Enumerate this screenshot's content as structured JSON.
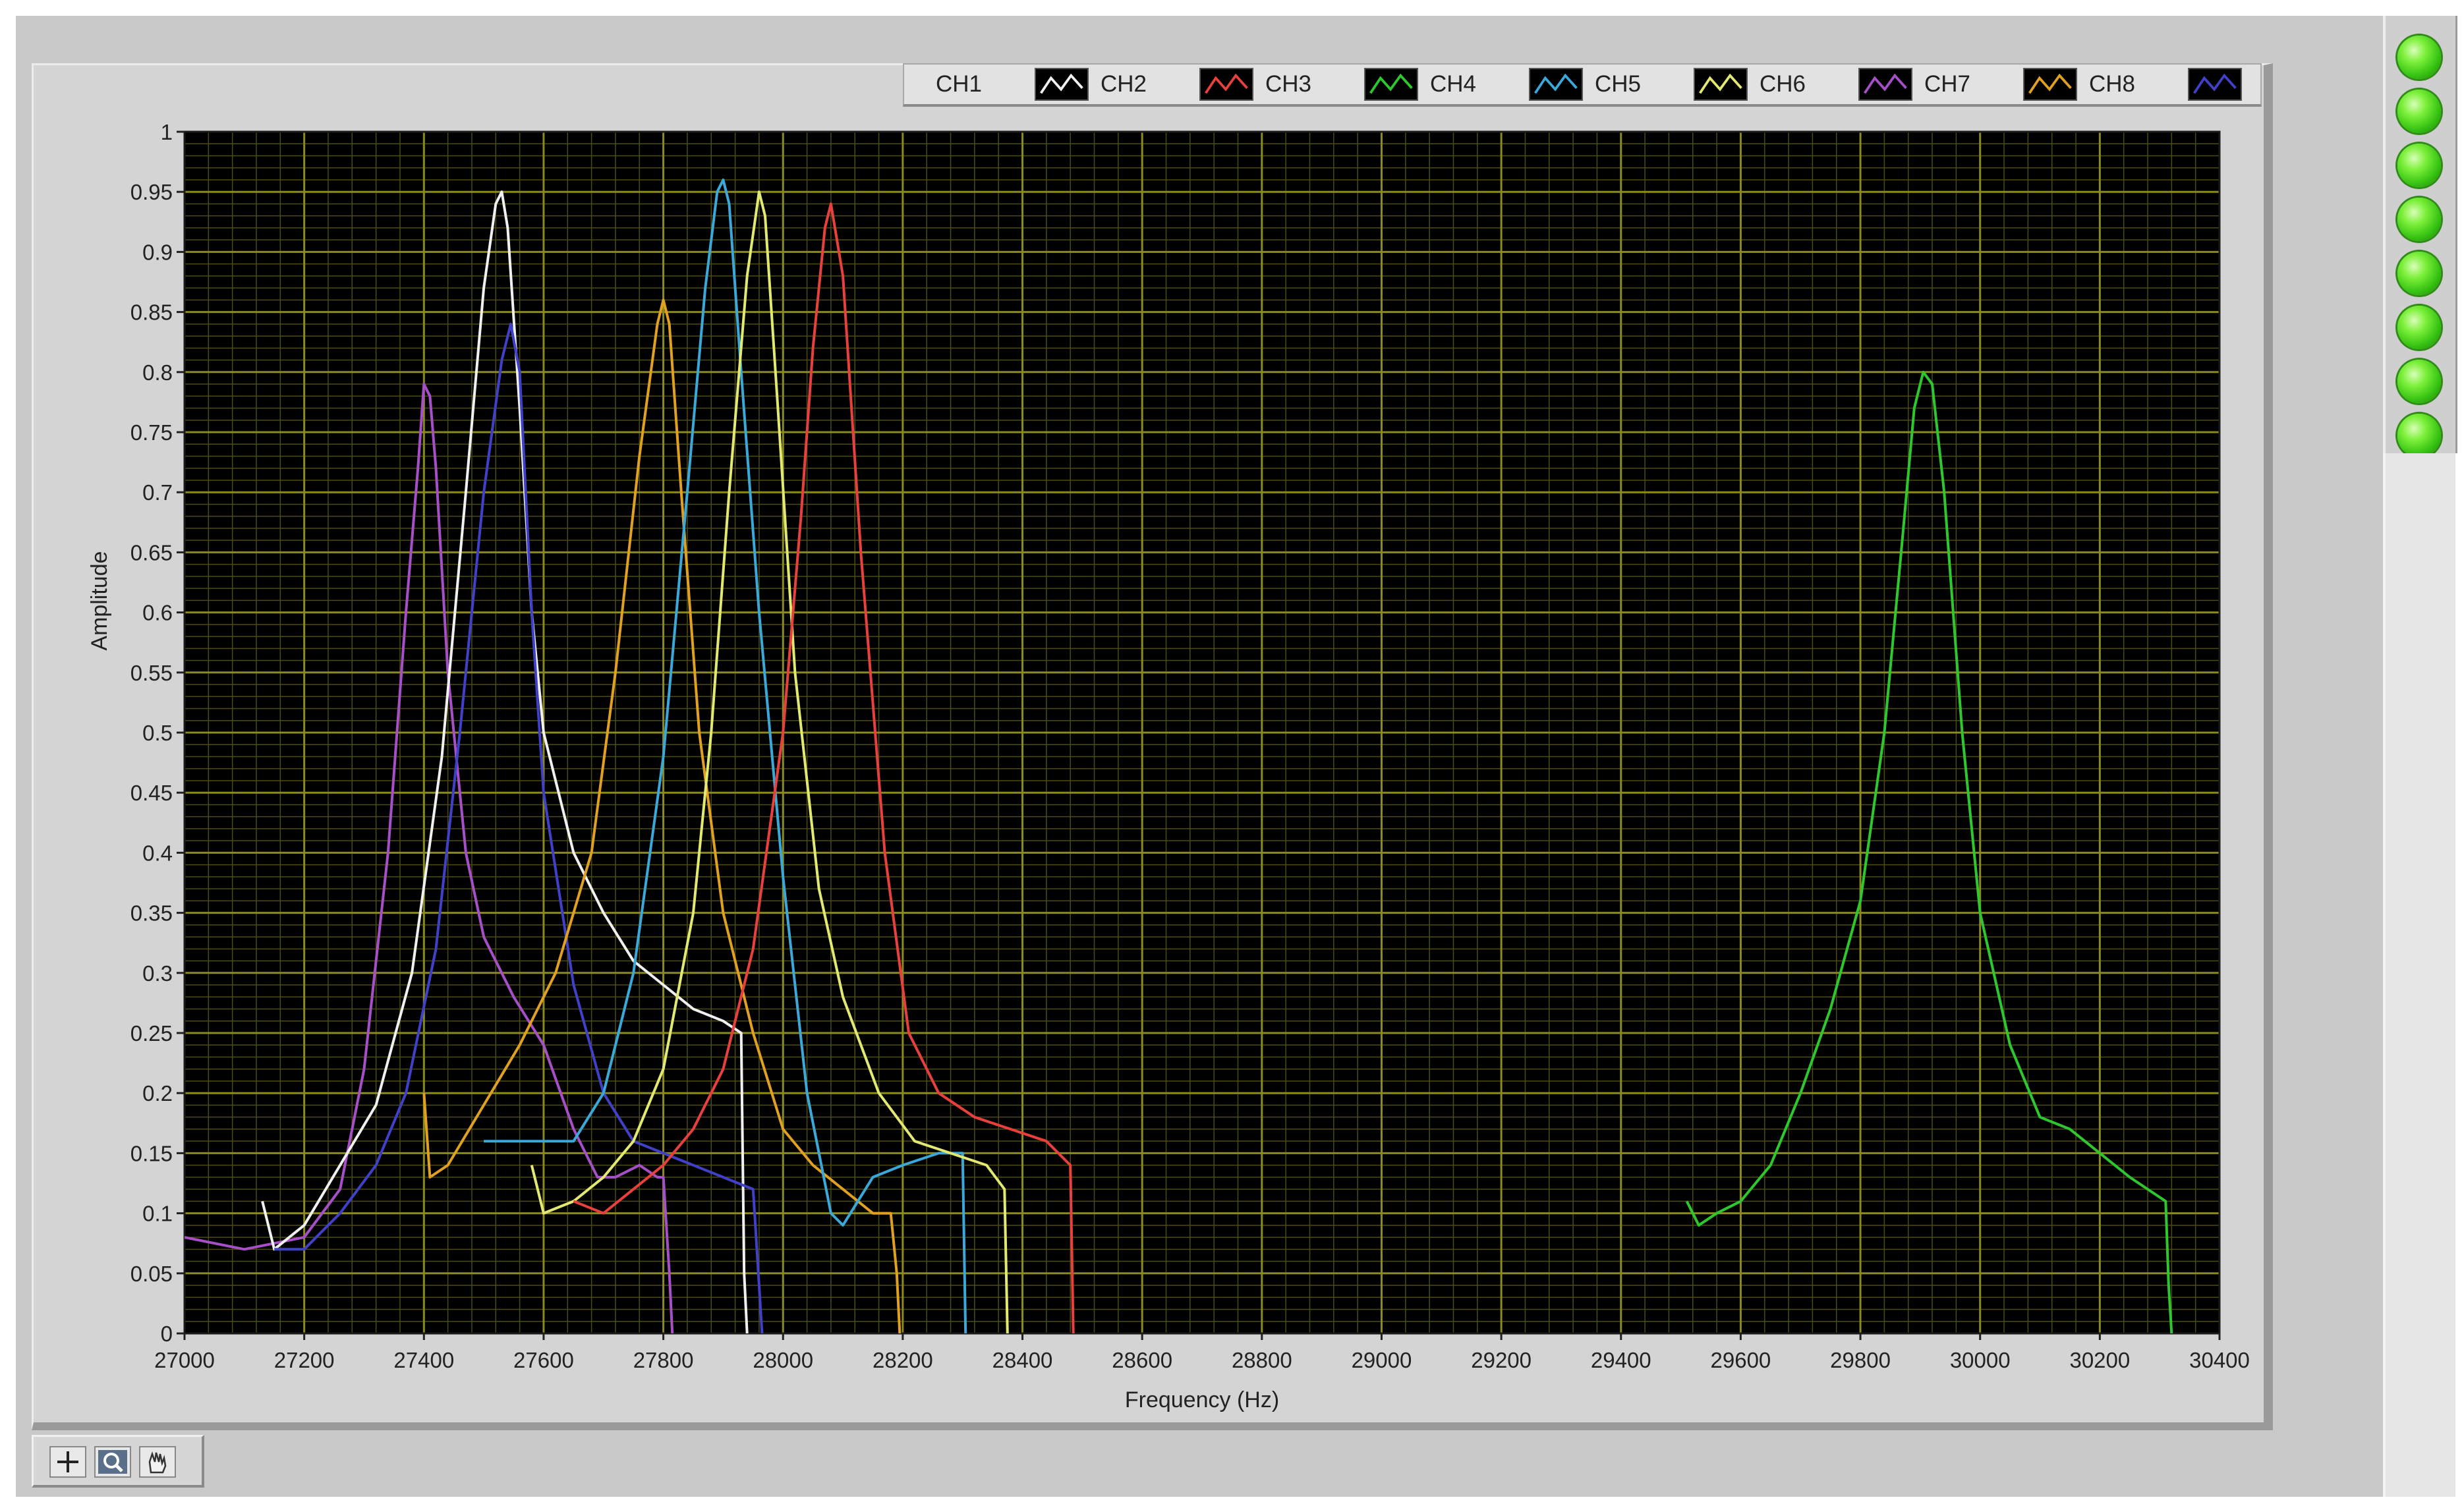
{
  "legend": {
    "items": [
      {
        "label": "CH1",
        "color": "#f0f0f0"
      },
      {
        "label": "CH2",
        "color": "#e8403c"
      },
      {
        "label": "CH3",
        "color": "#2ec82e"
      },
      {
        "label": "CH4",
        "color": "#3aa8d8"
      },
      {
        "label": "CH5",
        "color": "#e2e870"
      },
      {
        "label": "CH6",
        "color": "#a64fc8"
      },
      {
        "label": "CH7",
        "color": "#e0a020"
      },
      {
        "label": "CH8",
        "color": "#4040c8"
      }
    ]
  },
  "leds": {
    "count": 8,
    "state": "on",
    "color": "#36c212"
  },
  "toolbar": {
    "tools": [
      "cursor-move-icon",
      "zoom-icon",
      "pan-hand-icon"
    ]
  },
  "chart_data": {
    "type": "line",
    "xlabel": "Frequency (Hz)",
    "ylabel": "Amplitude",
    "xlim": [
      27000,
      30400
    ],
    "ylim": [
      0,
      1
    ],
    "x_ticks": [
      "27000",
      "27200",
      "27400",
      "27600",
      "27800",
      "28000",
      "28200",
      "28400",
      "28600",
      "28800",
      "29000",
      "29200",
      "29400",
      "29600",
      "29800",
      "30000",
      "30200",
      "30400"
    ],
    "y_ticks": [
      "0",
      "0.05",
      "0.1",
      "0.15",
      "0.2",
      "0.25",
      "0.3",
      "0.35",
      "0.4",
      "0.45",
      "0.5",
      "0.55",
      "0.6",
      "0.65",
      "0.7",
      "0.75",
      "0.8",
      "0.85",
      "0.9",
      "0.95",
      "1"
    ],
    "grid": true,
    "plot_background": "#000000",
    "grid_color": "#8a8a20",
    "series": [
      {
        "name": "CH7",
        "color": "#a64fc8",
        "x": [
          27000,
          27100,
          27200,
          27260,
          27300,
          27340,
          27370,
          27390,
          27400,
          27410,
          27420,
          27440,
          27470,
          27500,
          27550,
          27600,
          27650,
          27690,
          27720,
          27760,
          27790,
          27800,
          27810,
          27815
        ],
        "y": [
          0.08,
          0.07,
          0.08,
          0.12,
          0.22,
          0.4,
          0.6,
          0.72,
          0.79,
          0.78,
          0.72,
          0.55,
          0.4,
          0.33,
          0.28,
          0.24,
          0.17,
          0.13,
          0.13,
          0.14,
          0.13,
          0.13,
          0.05,
          0
        ]
      },
      {
        "name": "CH1",
        "color": "#f0f0f0",
        "x": [
          27130,
          27150,
          27200,
          27260,
          27320,
          27380,
          27430,
          27470,
          27500,
          27520,
          27530,
          27540,
          27560,
          27580,
          27600,
          27650,
          27700,
          27750,
          27800,
          27850,
          27900,
          27930,
          27935,
          27940
        ],
        "y": [
          0.11,
          0.07,
          0.09,
          0.14,
          0.19,
          0.3,
          0.48,
          0.7,
          0.87,
          0.94,
          0.95,
          0.92,
          0.77,
          0.6,
          0.5,
          0.4,
          0.35,
          0.31,
          0.29,
          0.27,
          0.26,
          0.25,
          0.05,
          0
        ]
      },
      {
        "name": "CH8",
        "color": "#4040c8",
        "x": [
          27150,
          27200,
          27260,
          27320,
          27370,
          27420,
          27460,
          27500,
          27530,
          27545,
          27560,
          27580,
          27600,
          27650,
          27700,
          27750,
          27800,
          27850,
          27900,
          27950,
          27960,
          27965
        ],
        "y": [
          0.07,
          0.07,
          0.1,
          0.14,
          0.2,
          0.32,
          0.5,
          0.7,
          0.81,
          0.84,
          0.8,
          0.6,
          0.45,
          0.29,
          0.2,
          0.16,
          0.15,
          0.14,
          0.13,
          0.12,
          0.04,
          0
        ]
      },
      {
        "name": "CH7 (orange)",
        "color": "#e0a020",
        "x": [
          27400,
          27410,
          27440,
          27500,
          27560,
          27620,
          27680,
          27720,
          27760,
          27790,
          27800,
          27810,
          27830,
          27860,
          27900,
          27950,
          28000,
          28050,
          28100,
          28150,
          28180,
          28190,
          28195
        ],
        "y": [
          0.2,
          0.13,
          0.14,
          0.19,
          0.24,
          0.3,
          0.4,
          0.55,
          0.73,
          0.84,
          0.86,
          0.84,
          0.7,
          0.5,
          0.35,
          0.25,
          0.17,
          0.14,
          0.12,
          0.1,
          0.1,
          0.05,
          0
        ]
      },
      {
        "name": "CH4",
        "color": "#3aa8d8",
        "x": [
          27500,
          27550,
          27600,
          27650,
          27700,
          27750,
          27800,
          27840,
          27870,
          27890,
          27900,
          27910,
          27930,
          27960,
          28000,
          28040,
          28080,
          28100,
          28150,
          28200,
          28260,
          28300,
          28305
        ],
        "y": [
          0.16,
          0.16,
          0.16,
          0.16,
          0.2,
          0.3,
          0.48,
          0.7,
          0.87,
          0.95,
          0.96,
          0.94,
          0.8,
          0.6,
          0.38,
          0.2,
          0.1,
          0.09,
          0.13,
          0.14,
          0.15,
          0.15,
          0
        ]
      },
      {
        "name": "CH5",
        "color": "#e2e870",
        "x": [
          27580,
          27600,
          27650,
          27700,
          27750,
          27800,
          27850,
          27880,
          27910,
          27940,
          27960,
          27970,
          27990,
          28020,
          28060,
          28100,
          28160,
          28220,
          28280,
          28340,
          28370,
          28375
        ],
        "y": [
          0.14,
          0.1,
          0.11,
          0.13,
          0.16,
          0.22,
          0.35,
          0.5,
          0.7,
          0.88,
          0.95,
          0.93,
          0.78,
          0.55,
          0.37,
          0.28,
          0.2,
          0.16,
          0.15,
          0.14,
          0.12,
          0
        ]
      },
      {
        "name": "CH2",
        "color": "#e8403c",
        "x": [
          27650,
          27700,
          27750,
          27800,
          27850,
          27900,
          27950,
          28000,
          28030,
          28050,
          28070,
          28080,
          28100,
          28130,
          28170,
          28210,
          28260,
          28320,
          28380,
          28440,
          28480,
          28485
        ],
        "y": [
          0.11,
          0.1,
          0.12,
          0.14,
          0.17,
          0.22,
          0.32,
          0.5,
          0.68,
          0.82,
          0.92,
          0.94,
          0.88,
          0.65,
          0.4,
          0.25,
          0.2,
          0.18,
          0.17,
          0.16,
          0.14,
          0
        ]
      },
      {
        "name": "CH3",
        "color": "#2ec82e",
        "x": [
          29510,
          29530,
          29560,
          29600,
          29650,
          29700,
          29750,
          29800,
          29840,
          29870,
          29890,
          29905,
          29920,
          29940,
          29970,
          30000,
          30050,
          30100,
          30150,
          30200,
          30250,
          30310,
          30315,
          30320
        ],
        "y": [
          0.11,
          0.09,
          0.1,
          0.11,
          0.14,
          0.2,
          0.27,
          0.36,
          0.5,
          0.66,
          0.77,
          0.8,
          0.79,
          0.7,
          0.5,
          0.35,
          0.24,
          0.18,
          0.17,
          0.15,
          0.13,
          0.11,
          0.04,
          0
        ]
      }
    ]
  }
}
